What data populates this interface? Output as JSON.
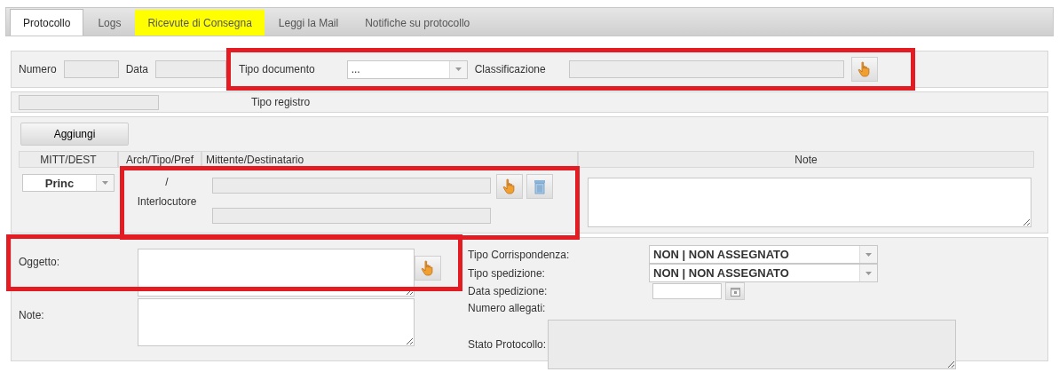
{
  "tabs": [
    {
      "label": "Protocollo",
      "selected": true,
      "highlighted": false
    },
    {
      "label": "Logs",
      "selected": false,
      "highlighted": false
    },
    {
      "label": "Ricevute di Consegna",
      "selected": false,
      "highlighted": true
    },
    {
      "label": "Leggi la Mail",
      "selected": false,
      "highlighted": false
    },
    {
      "label": "Notifiche su protocollo",
      "selected": false,
      "highlighted": false
    }
  ],
  "header": {
    "highlighted": true,
    "numero": {
      "label": "Numero"
    },
    "data": {
      "label": "Data"
    },
    "tipo_documento": {
      "label": "Tipo documento",
      "value": "..."
    },
    "classificazione": {
      "label": "Classificazione"
    }
  },
  "tipo_registro": {
    "label": "Tipo registro"
  },
  "correspondents": {
    "add_button": "Aggiungi",
    "columns": [
      "MITT/DEST",
      "Arch/Tipo/Pref",
      "Mittente/Destinatario",
      "Note"
    ],
    "rows": [
      {
        "role": "Princ",
        "arch": "/",
        "type": "Interlocutore",
        "highlighted": true
      }
    ]
  },
  "details": {
    "oggetto": {
      "label": "Oggetto:",
      "highlighted": true
    },
    "note": {
      "label": "Note:"
    },
    "tipo_corrispondenza": {
      "label": "Tipo Corrispondenza:",
      "value": "NON | NON ASSEGNATO"
    },
    "tipo_spedizione": {
      "label": "Tipo spedizione:",
      "value": "NON | NON ASSEGNATO"
    },
    "data_spedizione": {
      "label": "Data spedizione:"
    },
    "numero_allegati": {
      "label": "Numero allegati:"
    },
    "stato_protocollo": {
      "label": "Stato Protocollo:"
    }
  }
}
